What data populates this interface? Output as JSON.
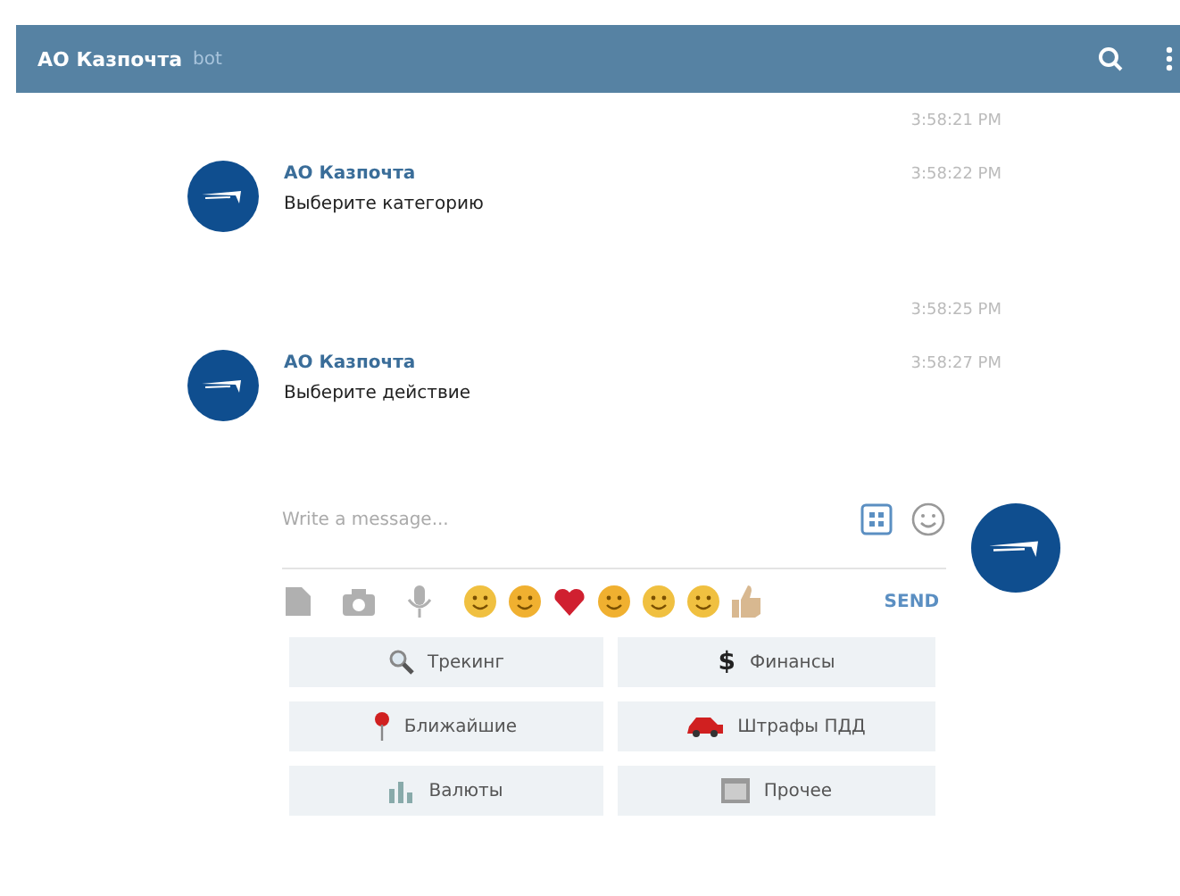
{
  "header": {
    "title": "АО Казпочта",
    "subtitle": "bot"
  },
  "messages": [
    {
      "kind": "time",
      "time": "3:58:21 PM"
    },
    {
      "kind": "message",
      "author": "АО Казпочта",
      "text": "Выберите категорию",
      "time": "3:58:22 PM"
    },
    {
      "kind": "time",
      "time": "3:58:25 PM"
    },
    {
      "kind": "message",
      "author": "АО Казпочта",
      "text": "Выберите действие",
      "time": "3:58:27 PM"
    }
  ],
  "composer": {
    "placeholder": "Write a message...",
    "send": "SEND"
  },
  "keyboard": [
    {
      "label": "Трекинг"
    },
    {
      "glyph": "$",
      "label": "Финансы"
    },
    {
      "label": "Ближайшие"
    },
    {
      "label": "Штрафы ПДД"
    },
    {
      "label": "Валюты"
    },
    {
      "label": "Прочее"
    }
  ]
}
